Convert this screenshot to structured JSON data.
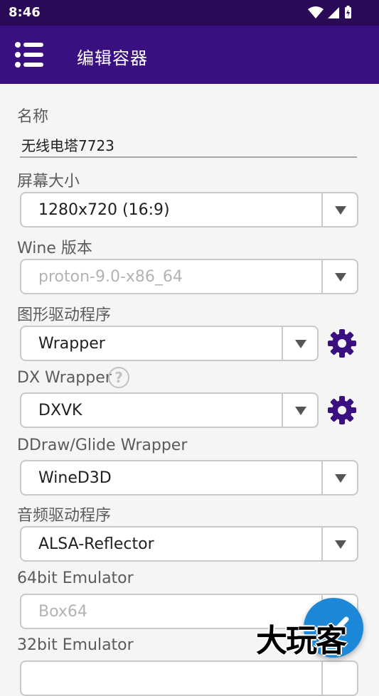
{
  "status_bar": {
    "time": "8:46"
  },
  "app_bar": {
    "title": "编辑容器"
  },
  "form": {
    "name_label": "名称",
    "name_value": "无线电塔7723",
    "screen_size_label": "屏幕大小",
    "screen_size_value": "1280x720 (16:9)",
    "wine_label": "Wine 版本",
    "wine_value": "proton-9.0-x86_64",
    "graphics_driver_label": "图形驱动程序",
    "graphics_driver_value": "Wrapper",
    "dx_wrapper_label": "DX Wrapper",
    "dx_wrapper_help": "?",
    "dx_wrapper_value": "DXVK",
    "ddraw_label": "DDraw/Glide Wrapper",
    "ddraw_value": "WineD3D",
    "audio_driver_label": "音频驱动程序",
    "audio_driver_value": "ALSA-Reflector",
    "emu64_label": "64bit Emulator",
    "emu64_value": "Box64",
    "emu32_label": "32bit Emulator"
  },
  "watermark": "大玩客",
  "colors": {
    "status_bar": "#2a0a57",
    "app_bar": "#3a0f80",
    "gear": "#3a0f80",
    "fab": "#1e88d8"
  }
}
